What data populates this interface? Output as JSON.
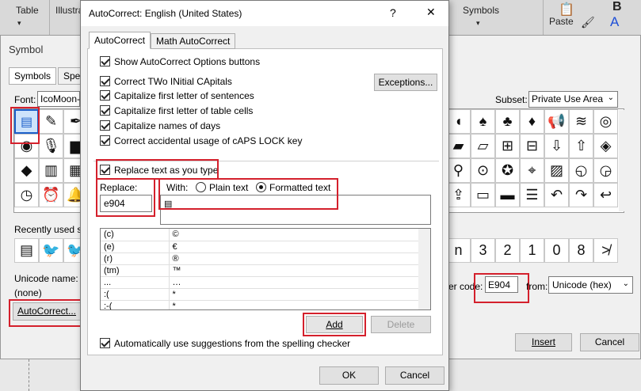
{
  "ribbon": {
    "table_label": "Table",
    "illustrations_label": "Illustra",
    "symbols_label": "Symbols",
    "paste_label": "Paste",
    "bold_label": "B",
    "font_color_label": "A"
  },
  "symbol_dialog": {
    "title": "Symbol",
    "tabs": [
      "Symbols",
      "Spec"
    ],
    "font_label": "Font:",
    "font_value": "IcoMoon-",
    "subset_label": "Subset:",
    "subset_value": "Private Use Area",
    "recently_used_label": "Recently used sy",
    "unicode_name_label": "Unicode name:",
    "unicode_name_value": "(none)",
    "char_code_label": "er code:",
    "char_code_value": "E904",
    "from_label": "from:",
    "from_value": "Unicode (hex)",
    "autocorrect_button": "AutoCorrect...",
    "insert_button": "Insert",
    "cancel_button": "Cancel",
    "shortcut_chars": [
      "n",
      "3",
      "2",
      "1",
      "0",
      "8",
      "≯"
    ]
  },
  "autocorrect": {
    "title": "AutoCorrect: English (United States)",
    "help_glyph": "?",
    "close_glyph": "✕",
    "tabs": [
      "AutoCorrect",
      "Math AutoCorrect"
    ],
    "options": [
      "Show AutoCorrect Options buttons",
      "Correct TWo INitial CApitals",
      "Capitalize first letter of sentences",
      "Capitalize first letter of table cells",
      "Capitalize names of days",
      "Correct accidental usage of cAPS LOCK key"
    ],
    "exceptions_button": "Exceptions...",
    "replace_as_you_type": "Replace text as you type",
    "replace_label": "Replace:",
    "with_label": "With:",
    "plain_text": "Plain text",
    "formatted_text": "Formatted text",
    "replace_value": "e904",
    "entries": [
      {
        "from": "(c)",
        "to": "©"
      },
      {
        "from": "(e)",
        "to": "€"
      },
      {
        "from": "(r)",
        "to": "®"
      },
      {
        "from": "(tm)",
        "to": "™"
      },
      {
        "from": "...",
        "to": "…"
      },
      {
        "from": ":(",
        "to": "*"
      },
      {
        "from": ":-(",
        "to": "*"
      }
    ],
    "add_button": "Add",
    "delete_button": "Delete",
    "suggestions": "Automatically use suggestions from the spelling checker",
    "ok_button": "OK",
    "cancel_button": "Cancel"
  }
}
